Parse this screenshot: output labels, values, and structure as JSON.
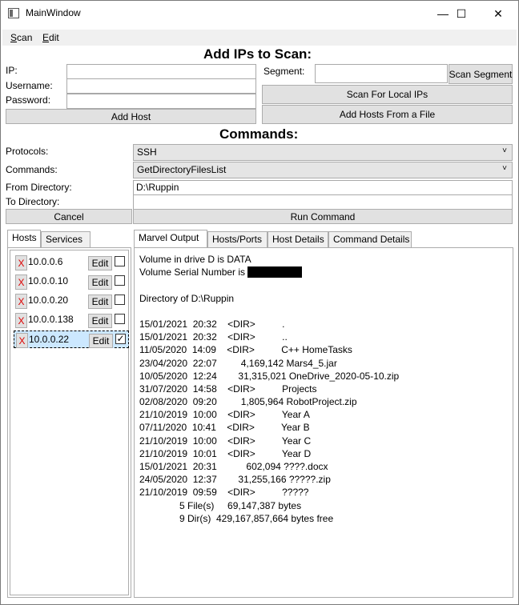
{
  "window": {
    "title": "MainWindow",
    "minimize_glyph": "—",
    "maximize_glyph": "☐",
    "close_glyph": "✕"
  },
  "menu": [
    {
      "mnemonic": "S",
      "rest": "can"
    },
    {
      "mnemonic": "E",
      "rest": "dit"
    }
  ],
  "add_ips": {
    "heading": "Add IPs to Scan:",
    "ip_label": "IP:",
    "ip_value": "",
    "username_label": "Username:",
    "username_value": "",
    "password_label": "Password:",
    "password_value": "",
    "add_host_button": "Add Host",
    "segment_label": "Segment:",
    "segment_value": "",
    "scan_segment_button": "Scan Segment",
    "scan_local_button": "Scan For Local IPs",
    "add_from_file_button": "Add Hosts From a File"
  },
  "commands": {
    "heading": "Commands:",
    "protocols_label": "Protocols:",
    "protocol_selected": "SSH",
    "commands_label": "Commands:",
    "command_selected": "GetDirectoryFilesList",
    "from_dir_label": "From Directory:",
    "from_dir_value": "D:\\Ruppin",
    "to_dir_label": "To Directory:",
    "to_dir_value": "",
    "cancel_button": "Cancel",
    "run_button": "Run Command",
    "dropdown_glyph": "˅"
  },
  "left_tabs": [
    "Hosts",
    "Services"
  ],
  "hosts": [
    {
      "ip": "10.0.0.6",
      "checked": false,
      "selected": false
    },
    {
      "ip": "10.0.0.10",
      "checked": false,
      "selected": false
    },
    {
      "ip": "10.0.0.20",
      "checked": false,
      "selected": false
    },
    {
      "ip": "10.0.0.138",
      "checked": false,
      "selected": false
    },
    {
      "ip": "10.0.0.22",
      "checked": true,
      "selected": true
    }
  ],
  "host_labels": {
    "remove": "X",
    "edit": "Edit",
    "check_glyph": "✓"
  },
  "right_tabs": [
    "Marvel Output",
    "Hosts/Ports",
    "Host Details",
    "Command Details"
  ],
  "output": {
    "volume_line": "Volume in drive D is DATA",
    "serial_line": "Volume Serial Number is ",
    "dir_line": "Directory of D:\\Ruppin",
    "listing": [
      "15/01/2021  20:32    <DIR>          .",
      "15/01/2021  20:32    <DIR>          ..",
      "11/05/2020  14:09    <DIR>          C++ HomeTasks",
      "23/04/2020  22:07         4,169,142 Mars4_5.jar",
      "10/05/2020  12:24        31,315,021 OneDrive_2020-05-10.zip",
      "31/07/2020  14:58    <DIR>          Projects",
      "02/08/2020  09:20         1,805,964 RobotProject.zip",
      "21/10/2019  10:00    <DIR>          Year A",
      "07/11/2020  10:41    <DIR>          Year B",
      "21/10/2019  10:00    <DIR>          Year C",
      "21/10/2019  10:01    <DIR>          Year D",
      "15/01/2021  20:31           602,094 ????.docx",
      "24/05/2020  12:37        31,255,166 ?????.zip",
      "21/10/2019  09:59    <DIR>          ?????"
    ],
    "summary": [
      "               5 File(s)     69,147,387 bytes",
      "               9 Dir(s)  429,167,857,664 bytes free"
    ]
  }
}
